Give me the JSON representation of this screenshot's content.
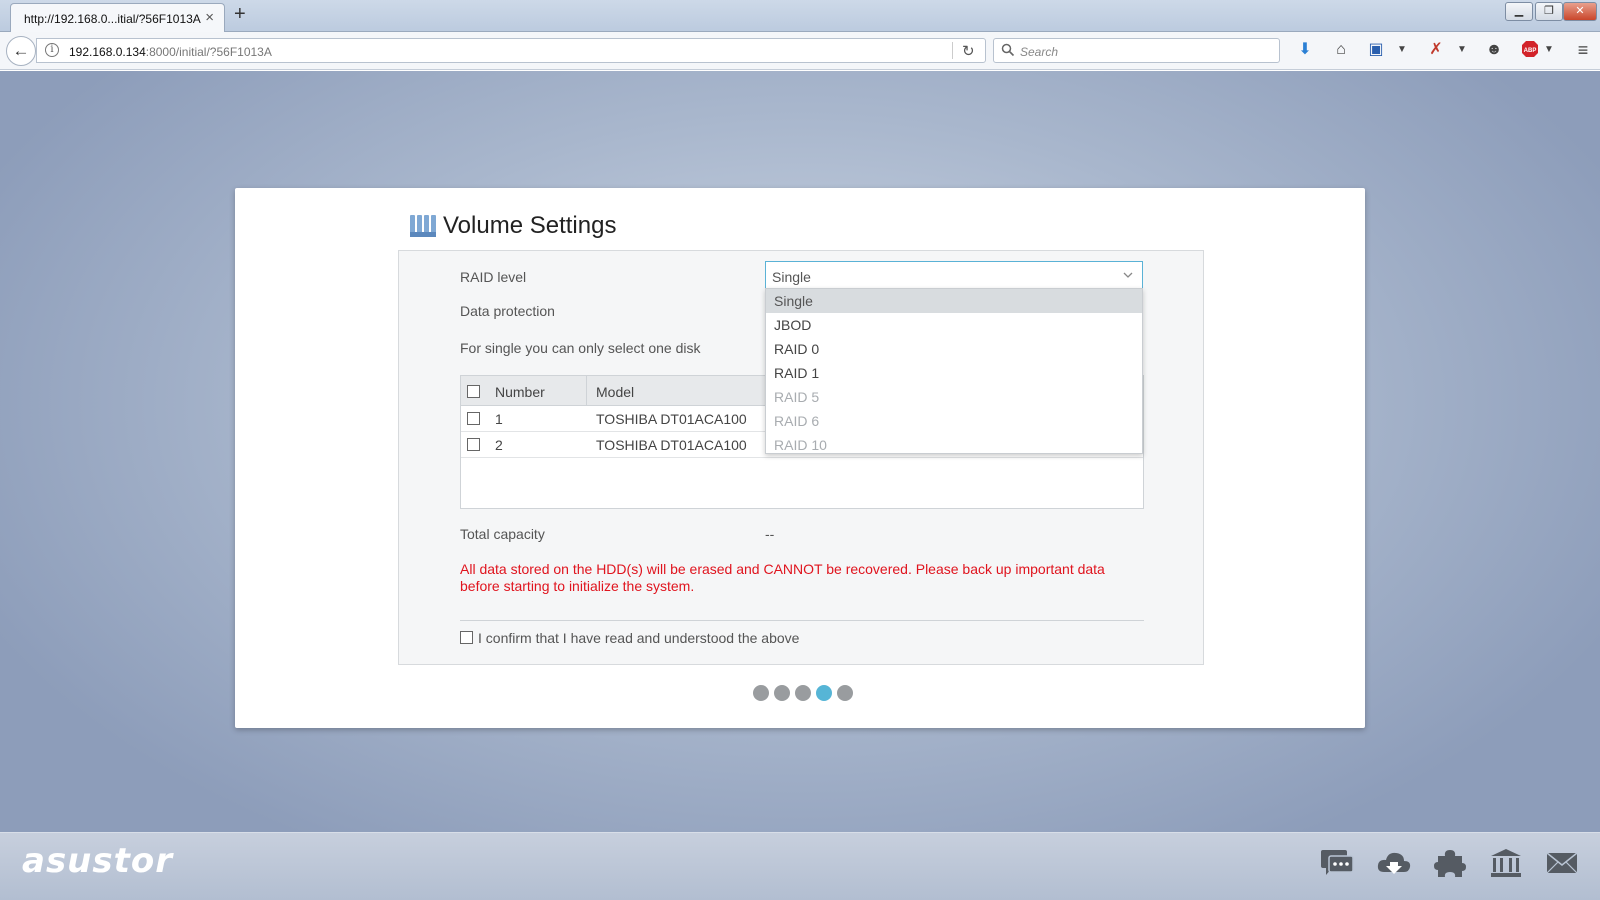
{
  "browser": {
    "tab_title": "http://192.168.0...itial/?56F1013A",
    "tab_close": "×",
    "new_tab": "+",
    "url_host": "192.168.0.134",
    "url_rest": ":8000/initial/?56F1013A",
    "search_placeholder": "Search",
    "window_controls": [
      "minimize",
      "restore",
      "close"
    ]
  },
  "card": {
    "title": "Volume Settings",
    "raid_label": "RAID level",
    "raid_value": "Single",
    "data_protection_label": "Data protection",
    "single_note": "For single you can only select one disk",
    "table": {
      "columns": [
        "Number",
        "Model"
      ],
      "rows": [
        {
          "number": "1",
          "model": "TOSHIBA DT01ACA100"
        },
        {
          "number": "2",
          "model": "TOSHIBA DT01ACA100"
        }
      ]
    },
    "total_capacity_label": "Total capacity",
    "total_capacity_value": "--",
    "warning": "All data stored on the HDD(s) will be erased and CANNOT be recovered. Please back up important data before starting to initialize the system.",
    "confirm_label": "I confirm that I have read and understood the above"
  },
  "dropdown": {
    "options": [
      {
        "label": "Single",
        "state": "selected"
      },
      {
        "label": "JBOD",
        "state": "enabled"
      },
      {
        "label": "RAID 0",
        "state": "enabled"
      },
      {
        "label": "RAID 1",
        "state": "enabled"
      },
      {
        "label": "RAID 5",
        "state": "disabled"
      },
      {
        "label": "RAID 6",
        "state": "disabled"
      },
      {
        "label": "RAID 10",
        "state": "disabled"
      }
    ]
  },
  "pager": {
    "total": 5,
    "active_index": 3
  },
  "footer": {
    "logo": "asustor",
    "icons": [
      "chat-icon",
      "cloud-download-icon",
      "puzzle-icon",
      "bank-icon",
      "mail-icon"
    ]
  },
  "colors": {
    "accent": "#56b5d6",
    "warning": "#e0141e",
    "select_border": "#5ab2d6"
  }
}
